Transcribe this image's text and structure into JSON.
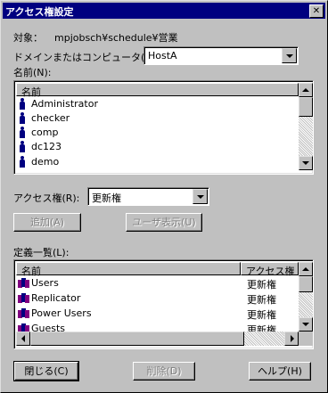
{
  "window": {
    "title": "アクセス権設定"
  },
  "target": {
    "label": "対象：",
    "value": "mpjobsch¥schedule¥営業"
  },
  "domain": {
    "label": "ドメインまたはコンピュータ(M):",
    "value": "HostA"
  },
  "names": {
    "label": "名前(N):",
    "column": "名前",
    "items": [
      "Administrator",
      "checker",
      "comp",
      "dc123",
      "demo"
    ]
  },
  "access": {
    "label": "アクセス権(R):",
    "value": "更新権"
  },
  "buttons": {
    "add": "追加(A)",
    "show_users": "ユーザ表示(U)",
    "close": "閉じる(C)",
    "delete": "削除(D)",
    "help": "ヘルプ(H)"
  },
  "definitions": {
    "label": "定義一覧(L):",
    "columns": [
      "名前",
      "アクセス権"
    ],
    "rows": [
      {
        "name": "Users",
        "permission": "更新権"
      },
      {
        "name": "Replicator",
        "permission": "更新権"
      },
      {
        "name": "Power Users",
        "permission": "更新権"
      },
      {
        "name": "Guests",
        "permission": "更新権"
      }
    ]
  },
  "colors": {
    "titlebar": "#000080",
    "face": "#c0c0c0"
  }
}
